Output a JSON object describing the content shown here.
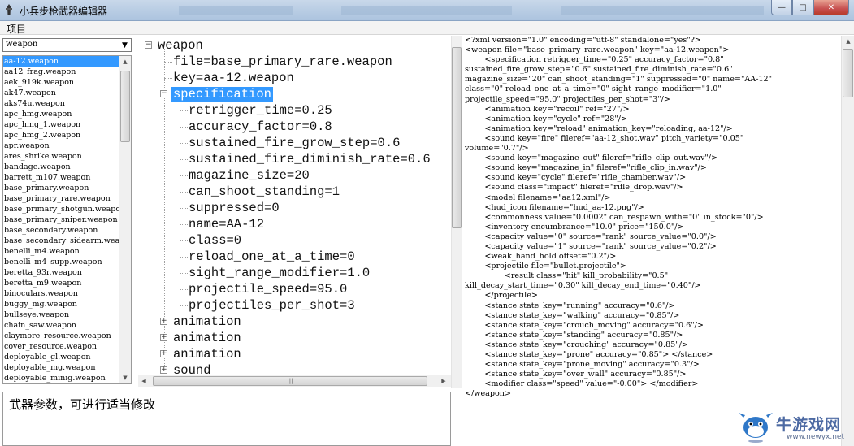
{
  "window": {
    "title": "小兵步枪武器编辑器",
    "buttons": {
      "minimize": "—",
      "maximize": "□",
      "close": "✕"
    }
  },
  "menu": {
    "items": [
      "项目"
    ]
  },
  "weapon_combo": {
    "value": "weapon",
    "arrow": "▼"
  },
  "weapon_list": {
    "selected_index": 0,
    "items": [
      "aa-12.weapon",
      "aa12_frag.weapon",
      "aek_919k.weapon",
      "ak47.weapon",
      "aks74u.weapon",
      "apc_hmg.weapon",
      "apc_hmg_1.weapon",
      "apc_hmg_2.weapon",
      "apr.weapon",
      "ares_shrike.weapon",
      "bandage.weapon",
      "barrett_m107.weapon",
      "base_primary.weapon",
      "base_primary_rare.weapon",
      "base_primary_shotgun.weapon",
      "base_primary_sniper.weapon",
      "base_secondary.weapon",
      "base_secondary_sidearm.weapon",
      "benelli_m4.weapon",
      "benelli_m4_supp.weapon",
      "beretta_93r.weapon",
      "beretta_m9.weapon",
      "binoculars.weapon",
      "buggy_mg.weapon",
      "bullseye.weapon",
      "chain_saw.weapon",
      "claymore_resource.weapon",
      "cover_resource.weapon",
      "deployable_gl.weapon",
      "deployable_mg.weapon",
      "deployable_minig.weapon"
    ]
  },
  "tree": {
    "root": "weapon",
    "file": "file=base_primary_rare.weapon",
    "key": "key=aa-12.weapon",
    "specification": {
      "label": "specification",
      "children": [
        "retrigger_time=0.25",
        "accuracy_factor=0.8",
        "sustained_fire_grow_step=0.6",
        "sustained_fire_diminish_rate=0.6",
        "magazine_size=20",
        "can_shoot_standing=1",
        "suppressed=0",
        "name=AA-12",
        "class=0",
        "reload_one_at_a_time=0",
        "sight_range_modifier=1.0",
        "projectile_speed=95.0",
        "projectiles_per_shot=3"
      ]
    },
    "collapsed": [
      "animation",
      "animation",
      "animation",
      "sound"
    ]
  },
  "memo": {
    "text": "武器参数，可进行适当修改"
  },
  "xml": {
    "lines": [
      "<?xml version=\"1.0\" encoding=\"utf-8\" standalone=\"yes\"?>",
      "<weapon file=\"base_primary_rare.weapon\" key=\"aa-12.weapon\">",
      "        <specification retrigger_time=\"0.25\" accuracy_factor=\"0.8\"",
      "sustained_fire_grow_step=\"0.6\" sustained_fire_diminish_rate=\"0.6\"",
      "magazine_size=\"20\" can_shoot_standing=\"1\" suppressed=\"0\" name=\"AA-12\"",
      "class=\"0\" reload_one_at_a_time=\"0\" sight_range_modifier=\"1.0\"",
      "projectile_speed=\"95.0\" projectiles_per_shot=\"3\"/>",
      "        <animation key=\"recoil\" ref=\"27\"/>",
      "        <animation key=\"cycle\" ref=\"28\"/>",
      "        <animation key=\"reload\" animation_key=\"reloading, aa-12\"/>",
      "        <sound key=\"fire\" fileref=\"aa-12_shot.wav\" pitch_variety=\"0.05\"",
      "volume=\"0.7\"/>",
      "        <sound key=\"magazine_out\" fileref=\"rifle_clip_out.wav\"/>",
      "        <sound key=\"magazine_in\" fileref=\"rifle_clip_in.wav\"/>",
      "        <sound key=\"cycle\" fileref=\"rifle_chamber.wav\"/>",
      "        <sound class=\"impact\" fileref=\"rifle_drop.wav\"/>",
      "        <model filename=\"aa12.xml\"/>",
      "        <hud_icon filename=\"hud_aa-12.png\"/>",
      "        <commonness value=\"0.0002\" can_respawn_with=\"0\" in_stock=\"0\"/>",
      "        <inventory encumbrance=\"10.0\" price=\"150.0\"/>",
      "        <capacity value=\"0\" source=\"rank\" source_value=\"0.0\"/>",
      "        <capacity value=\"1\" source=\"rank\" source_value=\"0.2\"/>",
      "        <weak_hand_hold offset=\"0.2\"/>",
      "        <projectile file=\"bullet.projectile\">",
      "                <result class=\"hit\" kill_probability=\"0.5\"",
      "kill_decay_start_time=\"0.30\" kill_decay_end_time=\"0.40\"/>",
      "        </projectile>",
      "        <stance state_key=\"running\" accuracy=\"0.6\"/>",
      "        <stance state_key=\"walking\" accuracy=\"0.85\"/>",
      "        <stance state_key=\"crouch_moving\" accuracy=\"0.6\"/>",
      "        <stance state_key=\"standing\" accuracy=\"0.85\"/>",
      "        <stance state_key=\"crouching\" accuracy=\"0.85\"/>",
      "        <stance state_key=\"prone\" accuracy=\"0.85\"> </stance>",
      "        <stance state_key=\"prone_moving\" accuracy=\"0.3\"/>",
      "        <stance state_key=\"over_wall\" accuracy=\"0.85\"/>",
      "        <modifier class=\"speed\" value=\"-0.00\"> </modifier>",
      "</weapon>"
    ]
  },
  "watermark": {
    "name": "牛游戏网",
    "url": "www.newyx.net"
  },
  "colors": {
    "selection": "#3399ff",
    "titlebar": "#b9cde4",
    "close_button": "#c75050"
  },
  "icons": [
    "app-icon",
    "minimize-icon",
    "maximize-icon",
    "close-icon",
    "dropdown-arrow-icon",
    "expand-icon",
    "collapse-icon",
    "cow-mascot-icon"
  ]
}
